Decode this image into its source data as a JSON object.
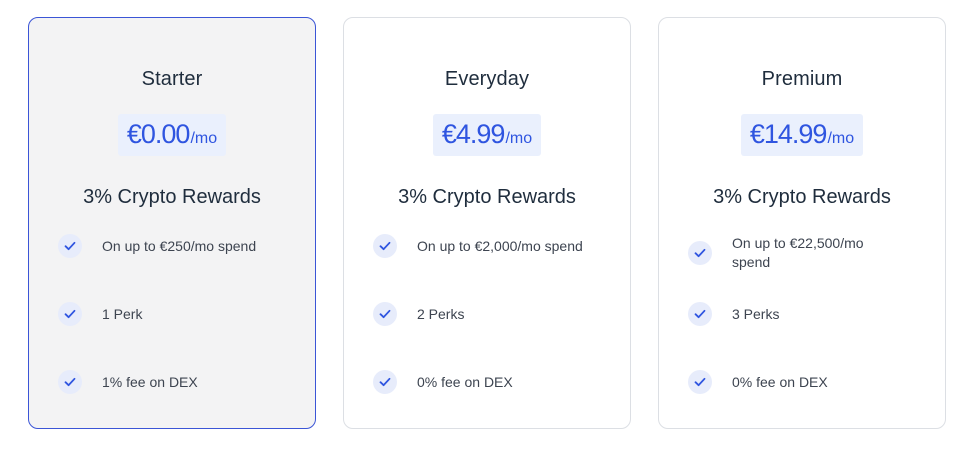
{
  "plans": [
    {
      "name": "Starter",
      "price": "€0.00",
      "period": "/mo",
      "rewards": "3% Crypto Rewards",
      "features": [
        "On up to €250/mo spend",
        "1 Perk",
        "1% fee on DEX"
      ],
      "selected": true
    },
    {
      "name": "Everyday",
      "price": "€4.99",
      "period": "/mo",
      "rewards": "3% Crypto Rewards",
      "features": [
        "On up to €2,000/mo spend",
        "2 Perks",
        "0% fee on DEX"
      ],
      "selected": false
    },
    {
      "name": "Premium",
      "price": "€14.99",
      "period": "/mo",
      "rewards": "3% Crypto Rewards",
      "features": [
        "On up to €22,500/mo spend",
        "3 Perks",
        "0% fee on DEX"
      ],
      "selected": false
    }
  ],
  "icons": {
    "feature_check": "check-icon"
  },
  "colors": {
    "accent": "#2f55e0",
    "selected_border": "#3b55d6",
    "price_background": "#eaf0fd",
    "check_background": "#e7ecfb",
    "selected_card_background": "#f3f3f4"
  }
}
